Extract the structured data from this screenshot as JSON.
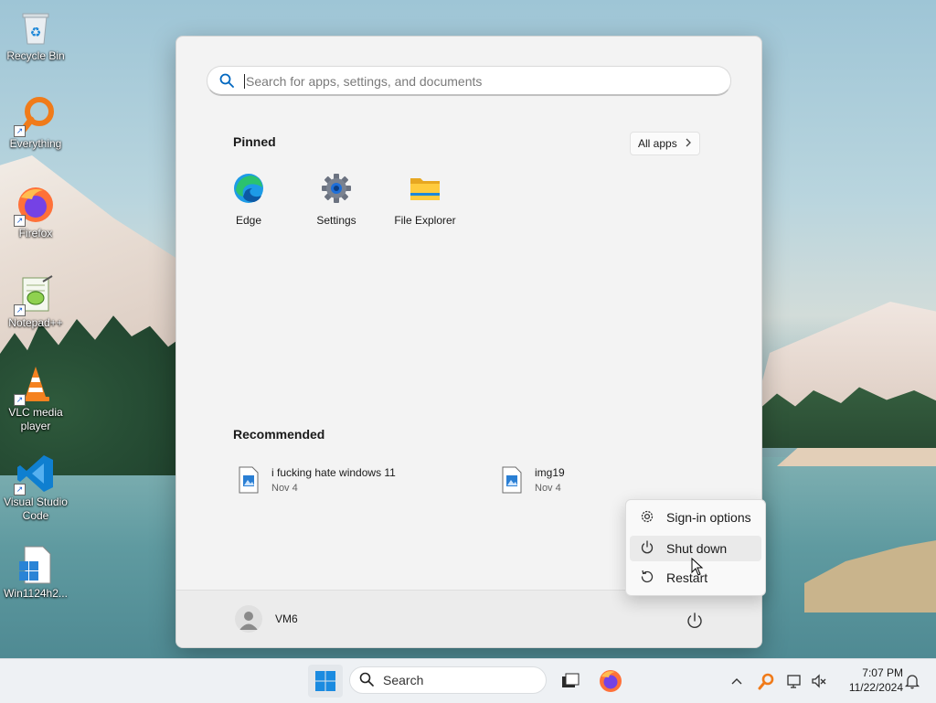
{
  "desktop": {
    "icons": [
      {
        "label": "Recycle Bin"
      },
      {
        "label": "Everything"
      },
      {
        "label": "Firefox"
      },
      {
        "label": "Notepad++"
      },
      {
        "label": "VLC media player"
      },
      {
        "label": "Visual Studio Code"
      },
      {
        "label": "Win1124h2..."
      }
    ]
  },
  "start_menu": {
    "search": {
      "placeholder": "Search for apps, settings, and documents",
      "value": ""
    },
    "pinned": {
      "title": "Pinned",
      "all_apps_label": "All apps",
      "apps": [
        {
          "label": "Edge",
          "icon": "edge-icon"
        },
        {
          "label": "Settings",
          "icon": "gear-icon"
        },
        {
          "label": "File Explorer",
          "icon": "folder-icon"
        }
      ]
    },
    "recommended": {
      "title": "Recommended",
      "items": [
        {
          "name": "i fucking hate windows 11",
          "date": "Nov 4"
        },
        {
          "name": "img19",
          "date": "Nov 4"
        }
      ]
    },
    "user": {
      "name": "VM6"
    }
  },
  "power_menu": {
    "items": [
      {
        "label": "Sign-in options",
        "icon": "gear-icon"
      },
      {
        "label": "Shut down",
        "icon": "power-icon"
      },
      {
        "label": "Restart",
        "icon": "restart-icon"
      }
    ]
  },
  "taskbar": {
    "search_label": "Search",
    "clock": {
      "time": "7:07 PM",
      "date": "11/22/2024"
    }
  },
  "colors": {
    "accent": "#0078d4",
    "taskbar_bg": "#eef1f4",
    "menu_bg": "#f3f3f3"
  }
}
